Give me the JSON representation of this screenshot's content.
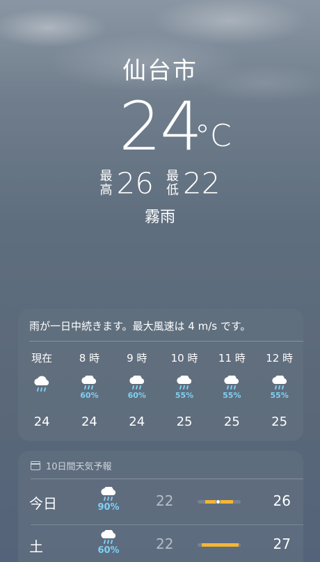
{
  "location": {
    "city": "仙台市"
  },
  "current": {
    "temperature": "24",
    "unit": "°C",
    "high_label_top": "最",
    "high_label_bottom": "高",
    "high": "26",
    "low_label_top": "最",
    "low_label_bottom": "低",
    "low": "22",
    "condition": "霧雨"
  },
  "hourly": {
    "summary": "雨が一日中続きます。最大風速は 4 m/s です。",
    "hours": [
      {
        "time": "現在",
        "icon": "rain-cloud-icon",
        "pct": "",
        "temp": "24"
      },
      {
        "time": "8 時",
        "icon": "rain-cloud-icon",
        "pct": "60%",
        "temp": "24"
      },
      {
        "time": "9 時",
        "icon": "rain-cloud-icon",
        "pct": "60%",
        "temp": "24"
      },
      {
        "time": "10 時",
        "icon": "rain-cloud-icon",
        "pct": "55%",
        "temp": "25"
      },
      {
        "time": "11 時",
        "icon": "rain-cloud-icon",
        "pct": "55%",
        "temp": "25"
      },
      {
        "time": "12 時",
        "icon": "rain-cloud-icon",
        "pct": "55%",
        "temp": "25"
      }
    ]
  },
  "daily": {
    "header": "10日間天気予報",
    "days": [
      {
        "name": "今日",
        "icon": "rain-cloud-icon",
        "pct": "90%",
        "low": "22",
        "high": "26"
      },
      {
        "name": "土",
        "icon": "rain-cloud-icon",
        "pct": "60%",
        "low": "22",
        "high": "27"
      }
    ]
  },
  "colors": {
    "precip": "#7fd0f5",
    "range_bar": "#f5b731"
  }
}
